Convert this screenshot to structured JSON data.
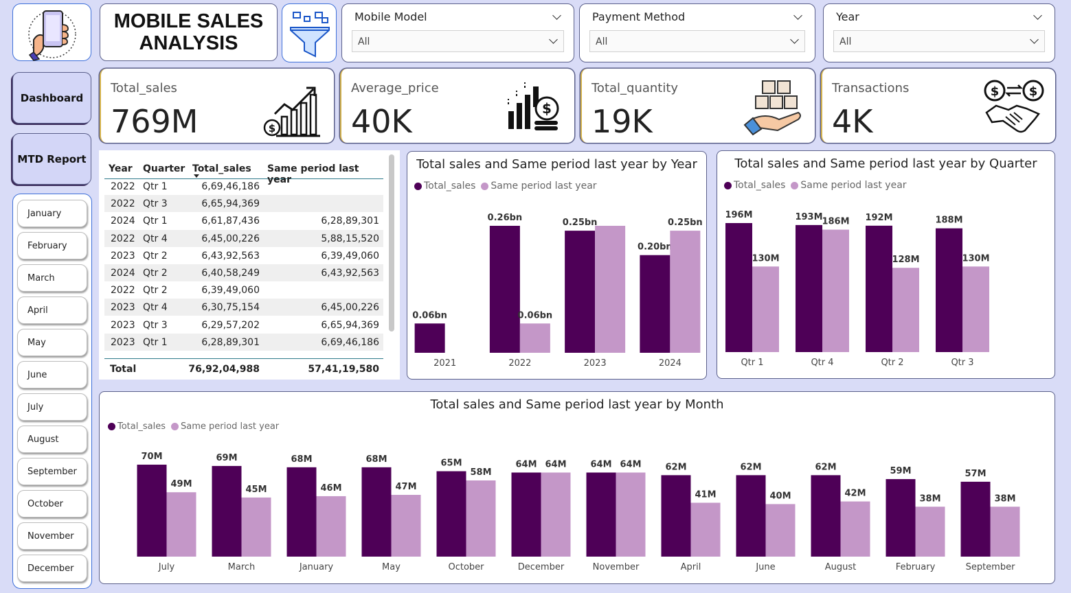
{
  "header": {
    "title_line1": "MOBILE SALES",
    "title_line2": "ANALYSIS"
  },
  "icons": {
    "logo": "phone-in-hand-icon",
    "filter": "funnel-filter-icon"
  },
  "slicers": [
    {
      "label": "Mobile Model",
      "value": "All"
    },
    {
      "label": "Payment Method",
      "value": "All"
    },
    {
      "label": "Year",
      "value": "All"
    }
  ],
  "nav": {
    "dashboard": "Dashboard",
    "mtd_report": "MTD Report"
  },
  "months": [
    "January",
    "February",
    "March",
    "April",
    "May",
    "June",
    "July",
    "August",
    "September",
    "October",
    "November",
    "December"
  ],
  "kpis": [
    {
      "label": "Total_sales",
      "value": "769M",
      "icon": "bar-growth-icon"
    },
    {
      "label": "Average_price",
      "value": "40K",
      "icon": "dollar-coins-icon"
    },
    {
      "label": "Total_quantity",
      "value": "19K",
      "icon": "boxes-in-hand-icon"
    },
    {
      "label": "Transactions",
      "value": "4K",
      "icon": "handshake-exchange-icon"
    }
  ],
  "table": {
    "columns": [
      "Year",
      "Quarter",
      "Total_sales",
      "Same period last year"
    ],
    "rows": [
      [
        "2022",
        "Qtr 1",
        "6,69,46,186",
        ""
      ],
      [
        "2022",
        "Qtr 3",
        "6,65,94,369",
        ""
      ],
      [
        "2024",
        "Qtr 1",
        "6,61,87,436",
        "6,28,89,301"
      ],
      [
        "2022",
        "Qtr 4",
        "6,45,00,226",
        "5,88,15,520"
      ],
      [
        "2023",
        "Qtr 2",
        "6,43,92,563",
        "6,39,49,060"
      ],
      [
        "2024",
        "Qtr 2",
        "6,40,58,249",
        "6,43,92,563"
      ],
      [
        "2022",
        "Qtr 2",
        "6,39,49,060",
        ""
      ],
      [
        "2023",
        "Qtr 4",
        "6,30,75,154",
        "6,45,00,226"
      ],
      [
        "2023",
        "Qtr 3",
        "6,29,57,202",
        "6,65,94,369"
      ],
      [
        "2023",
        "Qtr 1",
        "6,28,89,301",
        "6,69,46,186"
      ]
    ],
    "total_label": "Total",
    "total_sales": "76,92,04,988",
    "total_same_period": "57,41,19,580"
  },
  "legend": {
    "series1": "Total_sales",
    "series2": "Same period last year",
    "color1": "#4e0057",
    "color2": "#c497c8"
  },
  "chart_data": [
    {
      "type": "bar",
      "title": "Total sales and Same period last year by Year",
      "categories": [
        "2021",
        "2022",
        "2023",
        "2024"
      ],
      "series": [
        {
          "name": "Total_sales",
          "values": [
            0.06,
            0.26,
            0.25,
            0.2
          ],
          "labels": [
            "0.06bn",
            "0.26bn",
            "0.25bn",
            "0.20bn"
          ]
        },
        {
          "name": "Same period last year",
          "values": [
            0,
            0.06,
            0.26,
            0.25
          ],
          "labels": [
            "",
            "0.06bn",
            "",
            "0.25bn"
          ]
        }
      ],
      "ylim": [
        0,
        0.26
      ]
    },
    {
      "type": "bar",
      "title": "Total sales and Same period last year by Quarter",
      "categories": [
        "Qtr 1",
        "Qtr 4",
        "Qtr 2",
        "Qtr 3"
      ],
      "series": [
        {
          "name": "Total_sales",
          "values": [
            196,
            193,
            192,
            188
          ],
          "labels": [
            "196M",
            "193M",
            "192M",
            "188M"
          ]
        },
        {
          "name": "Same period last year",
          "values": [
            130,
            186,
            128,
            130
          ],
          "labels": [
            "130M",
            "186M",
            "128M",
            "130M"
          ]
        }
      ],
      "ylim": [
        0,
        196
      ]
    },
    {
      "type": "bar",
      "title": "Total sales and Same period last year by Month",
      "categories": [
        "July",
        "March",
        "January",
        "May",
        "October",
        "December",
        "November",
        "April",
        "June",
        "August",
        "February",
        "September"
      ],
      "series": [
        {
          "name": "Total_sales",
          "values": [
            70,
            69,
            68,
            68,
            65,
            64,
            64,
            62,
            62,
            62,
            59,
            57
          ],
          "labels": [
            "70M",
            "69M",
            "68M",
            "68M",
            "65M",
            "64M",
            "64M",
            "62M",
            "62M",
            "62M",
            "59M",
            "57M"
          ]
        },
        {
          "name": "Same period last year",
          "values": [
            49,
            45,
            46,
            47,
            58,
            64,
            64,
            41,
            40,
            42,
            38,
            38
          ],
          "labels": [
            "49M",
            "45M",
            "46M",
            "47M",
            "58M",
            "64M",
            "64M",
            "41M",
            "40M",
            "42M",
            "38M",
            "38M"
          ]
        }
      ],
      "ylim": [
        0,
        70
      ]
    }
  ]
}
